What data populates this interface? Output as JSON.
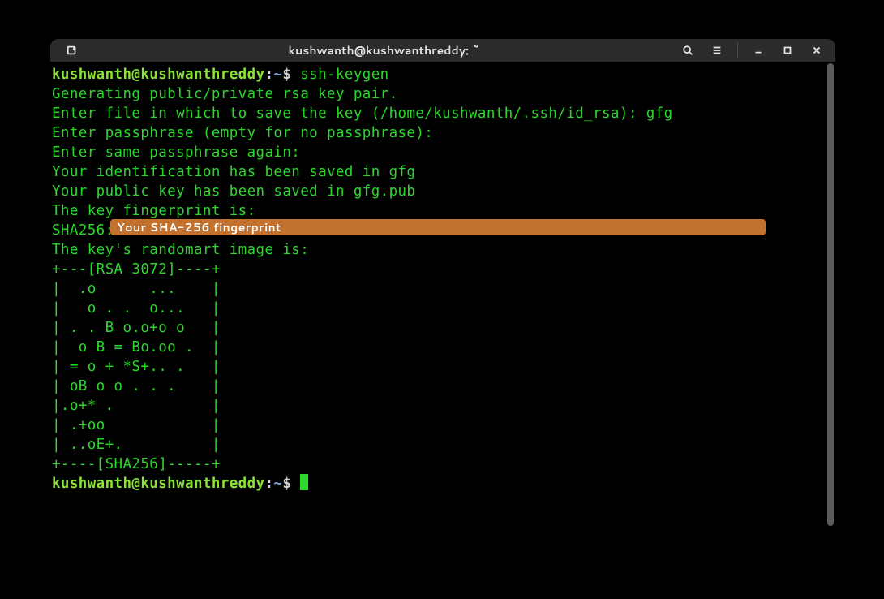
{
  "window": {
    "title": "kushwanth@kushwanthreddy: ~"
  },
  "prompt": {
    "user_host": "kushwanth@kushwanthreddy",
    "colon": ":",
    "path": "~",
    "dollar": "$"
  },
  "command": "ssh-keygen",
  "lines": {
    "gen": "Generating public/private rsa key pair.",
    "enterfile": "Enter file in which to save the key (/home/kushwanth/.ssh/id_rsa): gfg",
    "pass1": "Enter passphrase (empty for no passphrase):",
    "pass2": "Enter same passphrase again:",
    "saved_id": "Your identification has been saved in gfg",
    "saved_pub": "Your public key has been saved in gfg.pub",
    "fp_is": "The key fingerprint is:",
    "sha_prefix": "SHA256:",
    "rand_is": "The key's randomart image is:",
    "art00": "+---[RSA 3072]----+",
    "art01": "|  .o      ...    |",
    "art02": "|   o . .  o...   |",
    "art03": "| . . B o.o+o o   |",
    "art04": "|  o B = Bo.oo .  |",
    "art05": "| = o + *S+.. .   |",
    "art06": "| oB o o . . .    |",
    "art07": "|.o+* .           |",
    "art08": "| .+oo            |",
    "art09": "| ..oE+.          |",
    "art10": "+----[SHA256]-----+"
  },
  "redaction": {
    "label": "Your SHA-256 fingerprint"
  }
}
